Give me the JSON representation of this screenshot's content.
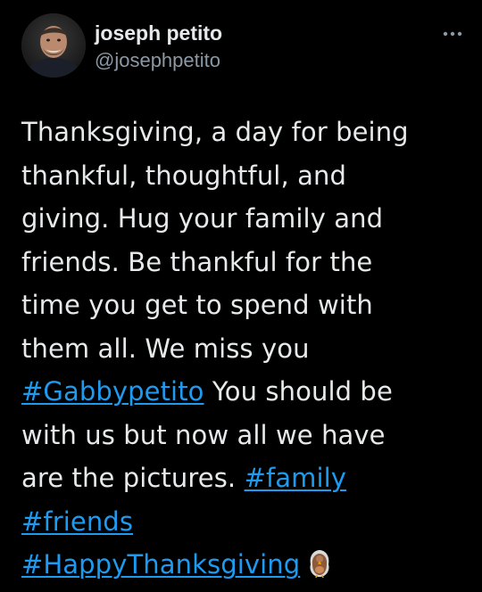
{
  "author": {
    "display_name": "joseph petito",
    "handle": "@josephpetito",
    "avatar_icon": "profile-photo",
    "more_icon": "more-dots-icon"
  },
  "tweet": {
    "line1": "Thanksgiving, a day for being",
    "line2": "thankful, thoughtful, and",
    "line3": "giving. Hug your family and",
    "line4": "friends. Be thankful for the",
    "line5": "time you get to spend with",
    "line6": "them all. We miss you",
    "hashtag_gabby": "#Gabbypetito",
    "line7_rest": " You should be",
    "line8": "with us but now all we have",
    "line9_text": "are the pictures. ",
    "hashtag_family": "#family",
    "hashtag_friends": "#friends",
    "hashtag_thanksgiving": "#HappyThanksgiving",
    "emoji_icon": "turkey-emoji"
  },
  "colors": {
    "background": "#000000",
    "text": "#e7e9ea",
    "secondary": "#8b98a5",
    "link": "#1d9bf0"
  }
}
